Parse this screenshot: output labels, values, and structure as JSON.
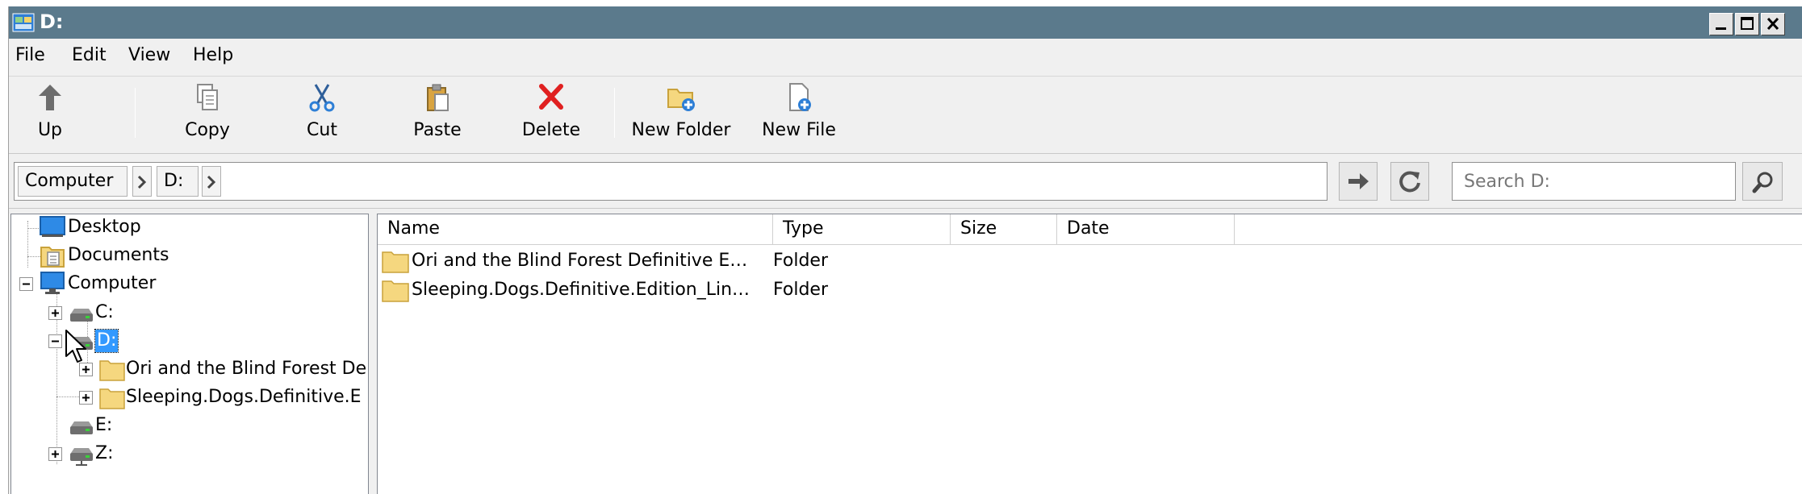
{
  "window": {
    "title": "D:"
  },
  "menu": [
    "File",
    "Edit",
    "View",
    "Help"
  ],
  "toolbar": {
    "up": "Up",
    "copy": "Copy",
    "cut": "Cut",
    "paste": "Paste",
    "delete": "Delete",
    "new_folder": "New Folder",
    "new_file": "New File"
  },
  "address": {
    "crumbs": [
      "Computer",
      "D:"
    ],
    "search_placeholder": "Search D:"
  },
  "tree": {
    "desktop": "Desktop",
    "documents": "Documents",
    "computer": "Computer",
    "drive_c": "C:",
    "drive_d": "D:",
    "folder_ori": "Ori and the Blind Forest De",
    "folder_sleeping": "Sleeping.Dogs.Definitive.E",
    "drive_e": "E:",
    "drive_z": "Z:"
  },
  "list": {
    "columns": [
      "Name",
      "Type",
      "Size",
      "Date"
    ],
    "rows": [
      {
        "name": "Ori and the Blind Forest Definitive E…",
        "type": "Folder"
      },
      {
        "name": "Sleeping.Dogs.Definitive.Edition_Lin…",
        "type": "Folder"
      }
    ]
  },
  "colors": {
    "titlebar": "#5b7a8c",
    "selection": "#3399ff",
    "folder": "#f5d77f"
  }
}
